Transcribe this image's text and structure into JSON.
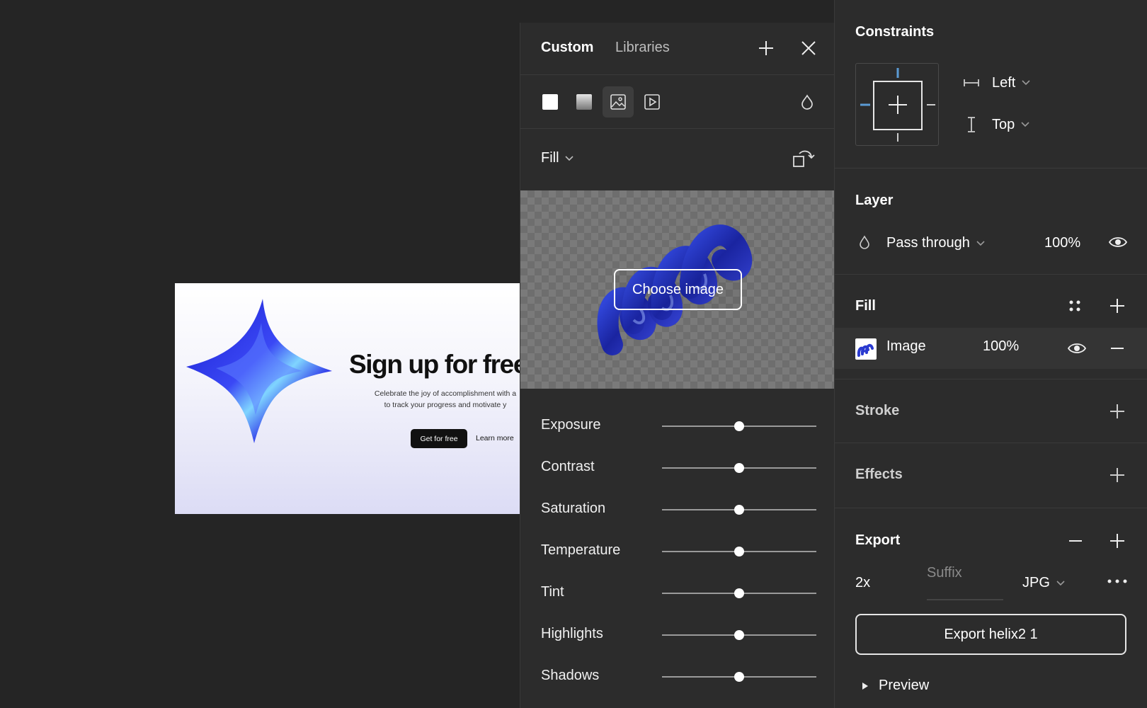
{
  "canvas": {
    "headline": "Sign up for free",
    "subtext_line1": "Celebrate the joy of accomplishment with a",
    "subtext_line2": "to track your progress and motivate y",
    "cta_label": "Get for free",
    "secondary_label": "Learn more"
  },
  "popover": {
    "tabs": [
      "Custom",
      "Libraries"
    ],
    "fill_mode": "Fill",
    "choose_image_label": "Choose image",
    "adjustments": [
      {
        "label": "Exposure",
        "value": 0.5
      },
      {
        "label": "Contrast",
        "value": 0.5
      },
      {
        "label": "Saturation",
        "value": 0.5
      },
      {
        "label": "Temperature",
        "value": 0.5
      },
      {
        "label": "Tint",
        "value": 0.5
      },
      {
        "label": "Highlights",
        "value": 0.5
      },
      {
        "label": "Shadows",
        "value": 0.5
      }
    ]
  },
  "panel": {
    "constraints": {
      "title": "Constraints",
      "horizontal": "Left",
      "vertical": "Top"
    },
    "layer": {
      "title": "Layer",
      "blend_mode": "Pass through",
      "opacity": "100%"
    },
    "fill": {
      "title": "Fill",
      "item_type": "Image",
      "item_opacity": "100%"
    },
    "stroke": {
      "title": "Stroke"
    },
    "effects": {
      "title": "Effects"
    },
    "export": {
      "title": "Export",
      "scale": "2x",
      "suffix_placeholder": "Suffix",
      "format": "JPG",
      "button_label": "Export helix2 1",
      "preview_label": "Preview"
    }
  },
  "colors": {
    "background": "#252525",
    "panel": "#2c2c2c",
    "constraint_accent": "#5b9bd5",
    "star_blue": "#2a2ee8",
    "helix_blue": "#1f2fb0"
  }
}
